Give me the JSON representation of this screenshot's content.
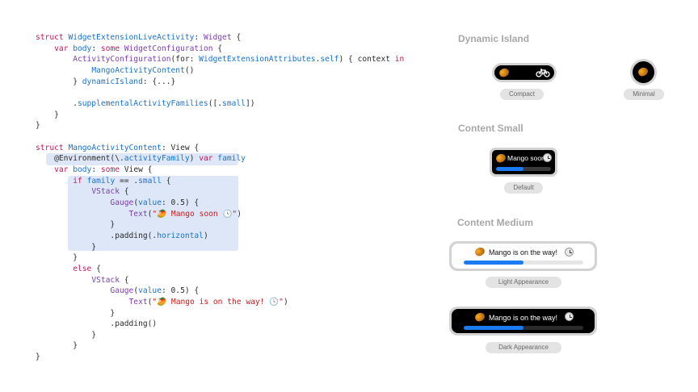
{
  "code": {
    "lines": [
      "struct WidgetExtensionLiveActivity: Widget {",
      "    var body: some WidgetConfiguration {",
      "        ActivityConfiguration(for: WidgetExtensionAttributes.self) { context in",
      "            MangoActivityContent()",
      "        } dynamicIsland: {...}",
      "",
      "        .supplementalActivityFamilies([.small])",
      "    }",
      "}",
      "",
      "struct MangoActivityContent: View {",
      "    @Environment(\\.activityFamily) var family",
      "    var body: some View {",
      "        if family == .small {",
      "            VStack {",
      "                Gauge(value: 0.5) {",
      "                    Text(\"🥭 Mango soon 🕓\")",
      "                }",
      "                .padding(.horizontal)",
      "            }",
      "        }",
      "        else {",
      "            VStack {",
      "                Gauge(value: 0.5) {",
      "                    Text(\"🥭 Mango is on the way! 🕓\")",
      "                }",
      "                .padding()",
      "            }",
      "        }",
      "}"
    ]
  },
  "sections": {
    "dynamic_island": "Dynamic Island",
    "content_small": "Content Small",
    "content_medium": "Content Medium"
  },
  "labels": {
    "compact": "Compact",
    "minimal": "Minimal",
    "default": "Default",
    "light": "Light Appearance",
    "dark": "Dark Appearance"
  },
  "widgets": {
    "small_text": "Mango soon",
    "medium_text": "Mango is on the way!",
    "progress": 0.5
  },
  "icons": {
    "mango": "mango-icon",
    "bicycle": "bicycle-icon",
    "clock": "clock-icon"
  },
  "colors": {
    "accent": "#1a7cf0",
    "keyword": "#c2185b",
    "type": "#7b3fb0",
    "property": "#1a73c8",
    "string": "#c41d1d"
  }
}
